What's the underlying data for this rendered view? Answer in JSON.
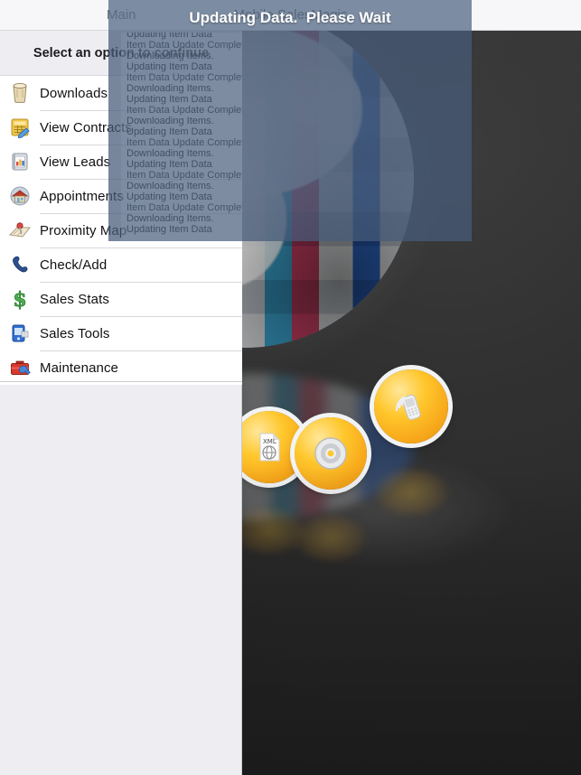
{
  "window": {
    "nav_left_label": "Main",
    "app_title": "Mobile SalesMagic"
  },
  "master": {
    "subtitle": "Select an option to continue",
    "menu": [
      {
        "label": "Downloads",
        "icon": "downloads-bucket-icon"
      },
      {
        "label": "View Contracts",
        "icon": "contract-form-icon"
      },
      {
        "label": "View Leads",
        "icon": "leads-chart-book-icon"
      },
      {
        "label": "Appointments",
        "icon": "appointments-house-icon"
      },
      {
        "label": "Proximity Map",
        "icon": "proximity-map-pin-icon"
      },
      {
        "label": "Check/Add",
        "icon": "phone-handset-icon"
      },
      {
        "label": "Sales Stats",
        "icon": "dollar-sign-icon"
      },
      {
        "label": "Sales Tools",
        "icon": "mobile-device-icon"
      },
      {
        "label": "Maintenance",
        "icon": "toolbox-wrench-icon"
      }
    ]
  },
  "modal": {
    "title": "Updating Data.  Please Wait",
    "log_lines": [
      "Updating Item Data",
      "Item Data Update Complete.",
      "Downloading Items.",
      "Updating Item Data",
      "Item Data Update Complete.",
      "Downloading Items.",
      "Updating Item Data",
      "Item Data Update Complete.",
      "Downloading Items.",
      "Updating Item Data",
      "Item Data Update Complete.",
      "Downloading Items.",
      "Updating Item Data",
      "Item Data Update Complete.",
      "Downloading Items.",
      "Updating Item Data",
      "Item Data Update Complete.",
      "Downloading Items.",
      "Updating Item Data"
    ]
  },
  "background": {
    "description": "globe-of-flags-with-orange-app-icons",
    "icons": [
      {
        "name": "xml-document-icon"
      },
      {
        "name": "disc-target-icon"
      },
      {
        "name": "mobile-phone-signal-icon"
      }
    ]
  },
  "colors": {
    "overlay": "#5c708c",
    "overlay_header": "#6f7f96",
    "master_bg": "#eeeef2",
    "list_bg": "#ffffff",
    "nav_bg": "#f7f7f9",
    "detail_bg": "#2e2e2e",
    "accent_orange": "#ffc72c"
  }
}
